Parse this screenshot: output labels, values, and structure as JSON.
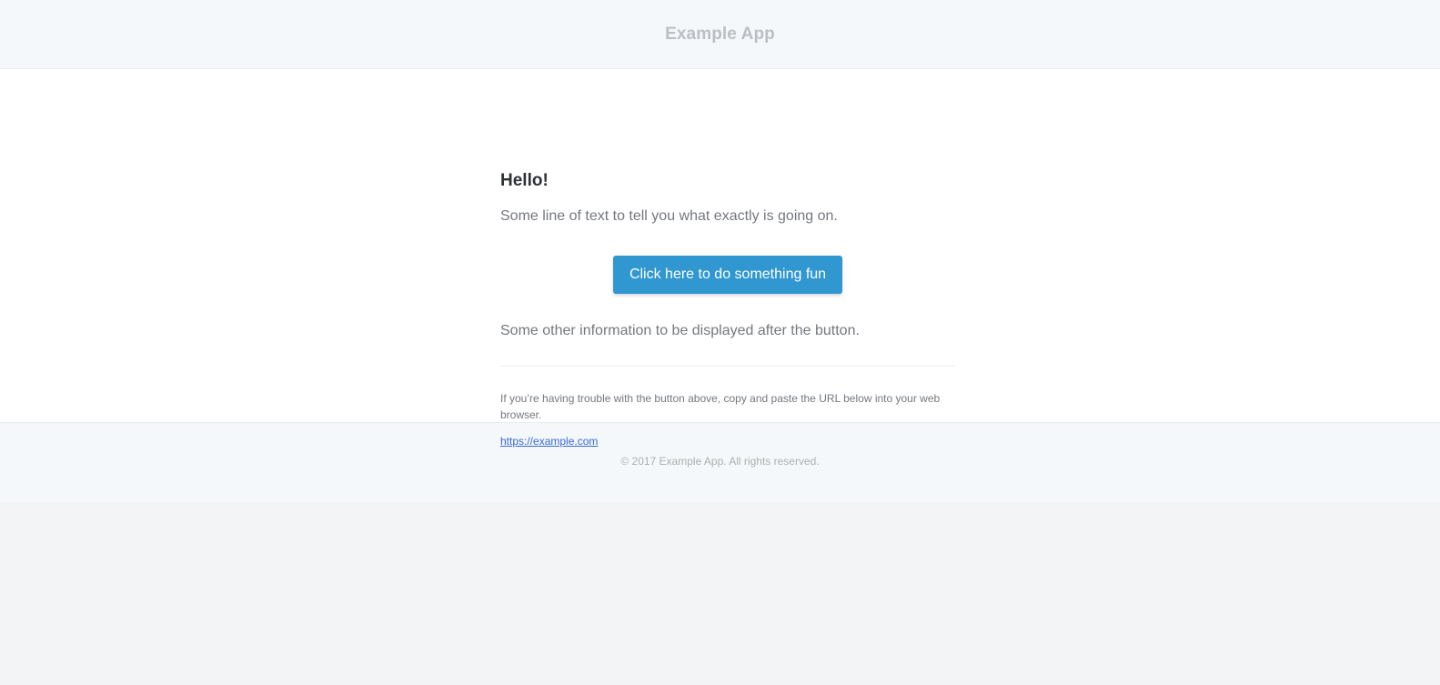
{
  "header": {
    "app_name": "Example App"
  },
  "content": {
    "greeting": "Hello!",
    "intro_line": "Some line of text to tell you what exactly is going on.",
    "action_button_label": "Click here to do something fun",
    "outro_line": "Some other information to be displayed after the button.",
    "subcopy_text": "If you’re having trouble with the button above, copy and paste the URL below into your web browser.",
    "subcopy_url": "https://example.com"
  },
  "footer": {
    "copyright": "© 2017 Example App. All rights reserved."
  },
  "colors": {
    "button": "#3097d1",
    "link": "#3869d4",
    "text": "#74787e",
    "heading": "#2f3133",
    "background": "#f5f8fa"
  }
}
